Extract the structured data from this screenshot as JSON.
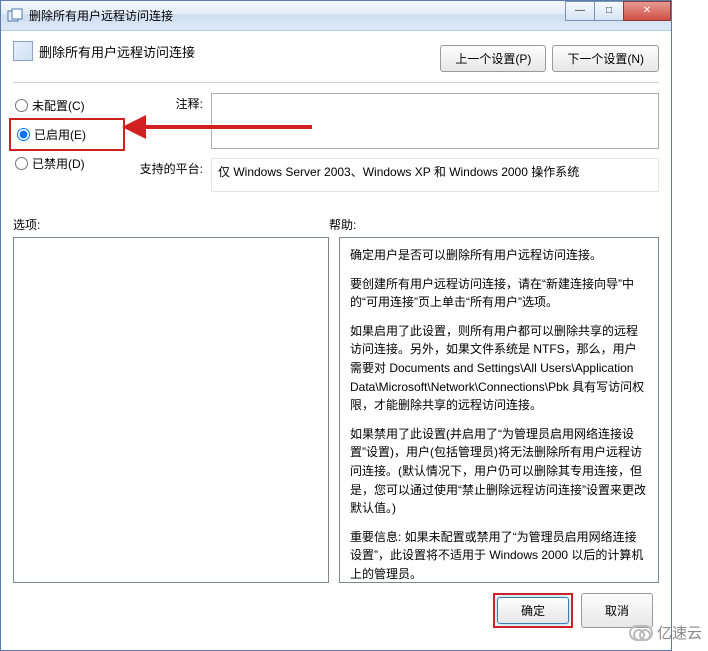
{
  "window": {
    "title": "删除所有用户远程访问连接"
  },
  "header": {
    "title": "删除所有用户远程访问连接",
    "prev_setting": "上一个设置(P)",
    "next_setting": "下一个设置(N)"
  },
  "radio": {
    "not_configured": "未配置(C)",
    "enabled": "已启用(E)",
    "disabled": "已禁用(D)",
    "selected": "enabled"
  },
  "fields": {
    "comment_label": "注释:",
    "comment_value": "",
    "platform_label": "支持的平台:",
    "platform_value": "仅 Windows Server 2003、Windows XP 和 Windows 2000 操作系统"
  },
  "body": {
    "options_label": "选项:",
    "help_label": "帮助:"
  },
  "help": {
    "p1": "确定用户是否可以删除所有用户远程访问连接。",
    "p2": "要创建所有用户远程访问连接，请在“新建连接向导”中的“可用连接”页上单击“所有用户”选项。",
    "p3": "如果启用了此设置，则所有用户都可以删除共享的远程访问连接。另外，如果文件系统是 NTFS，那么，用户需要对 Documents and Settings\\All Users\\Application Data\\Microsoft\\Network\\Connections\\Pbk 具有写访问权限，才能删除共享的远程访问连接。",
    "p4": "如果禁用了此设置(并启用了“为管理员启用网络连接设置”设置)，用户(包括管理员)将无法删除所有用户远程访问连接。(默认情况下，用户仍可以删除其专用连接，但是，您可以通过使用“禁止删除远程访问连接”设置来更改默认值。)",
    "p5": "重要信息: 如果未配置或禁用了“为管理员启用网络连接设置”，此设置将不适用于 Windows 2000 以后的计算机上的管理员。"
  },
  "footer": {
    "ok": "确定",
    "cancel": "取消"
  },
  "watermark": "亿速云"
}
